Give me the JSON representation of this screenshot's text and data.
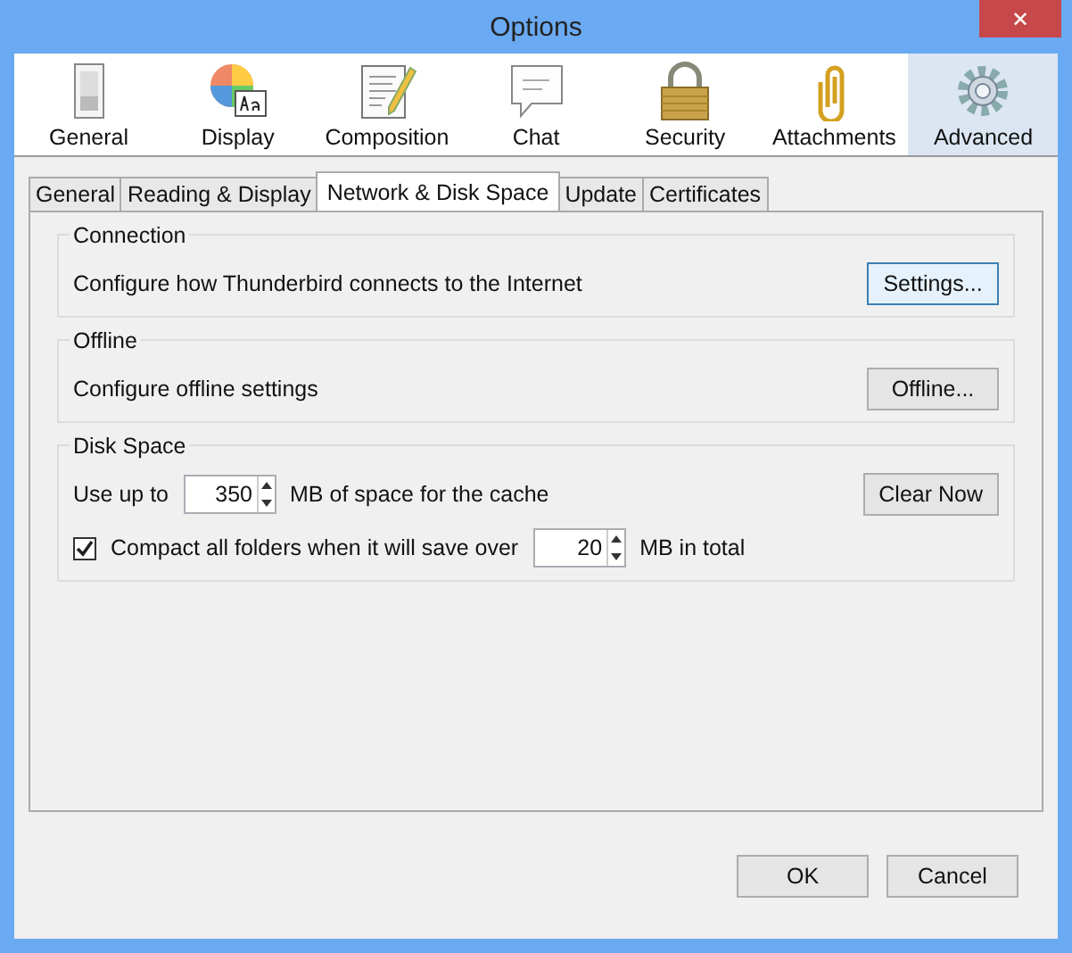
{
  "window": {
    "title": "Options",
    "close": "✕"
  },
  "panes": [
    {
      "label": "General",
      "selected": false
    },
    {
      "label": "Display",
      "selected": false
    },
    {
      "label": "Composition",
      "selected": false
    },
    {
      "label": "Chat",
      "selected": false
    },
    {
      "label": "Security",
      "selected": false
    },
    {
      "label": "Attachments",
      "selected": false
    },
    {
      "label": "Advanced",
      "selected": true
    }
  ],
  "tabs": [
    {
      "label": "General",
      "selected": false
    },
    {
      "label": "Reading & Display",
      "selected": false
    },
    {
      "label": "Network & Disk Space",
      "selected": true
    },
    {
      "label": "Update",
      "selected": false
    },
    {
      "label": "Certificates",
      "selected": false
    }
  ],
  "groups": [
    {
      "title": "Connection",
      "rows": [
        {
          "kind": "text",
          "text": "Configure how Thunderbird connects to the Internet",
          "button": {
            "label": "Settings...",
            "focused": true
          }
        }
      ]
    },
    {
      "title": "Offline",
      "rows": [
        {
          "kind": "text",
          "text": "Configure offline settings",
          "button": {
            "label": "Offline...",
            "focused": false
          }
        }
      ]
    },
    {
      "title": "Disk Space",
      "rows": [
        {
          "kind": "spinner",
          "label": "Use up to",
          "value": "350",
          "suffix": "MB of space for the cache",
          "button": {
            "label": "Clear Now",
            "focused": false
          }
        },
        {
          "kind": "check_spinner",
          "checked": true,
          "label": "Compact all folders when it will save over",
          "value": "20",
          "suffix": "MB in total"
        }
      ]
    }
  ],
  "buttons": [
    "OK",
    "Cancel"
  ]
}
